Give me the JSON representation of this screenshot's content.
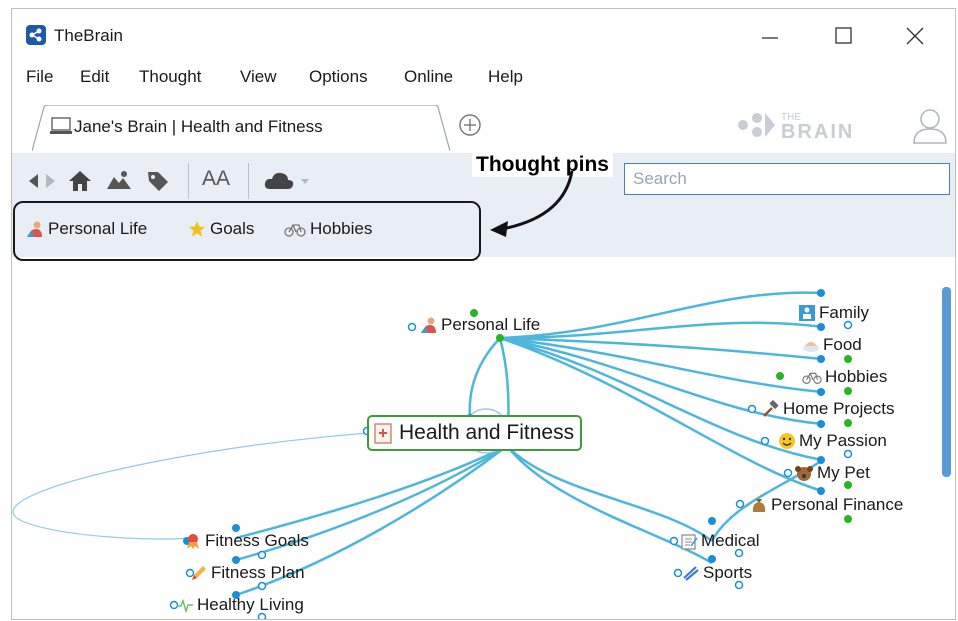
{
  "app": {
    "title": "TheBrain"
  },
  "menu": [
    "File",
    "Edit",
    "Thought",
    "View",
    "Options",
    "Online",
    "Help"
  ],
  "tab": {
    "label": "Jane's Brain | Health and Fitness"
  },
  "brand": {
    "logo_text_top": "THE",
    "logo_text_bottom": "BRAIN"
  },
  "toolbar": {
    "font_size_label": "AA"
  },
  "search": {
    "placeholder": "Search",
    "value": ""
  },
  "annotation": {
    "label": "Thought pins"
  },
  "pins": [
    {
      "label": "Personal Life",
      "icon": "person-icon"
    },
    {
      "label": "Goals",
      "icon": "star-icon"
    },
    {
      "label": "Hobbies",
      "icon": "bicycle-icon"
    }
  ],
  "plex": {
    "parent": {
      "label": "Personal Life"
    },
    "central": {
      "label": "Health and Fitness"
    },
    "jumps": [
      {
        "label": "Family"
      },
      {
        "label": "Food"
      },
      {
        "label": "Hobbies"
      },
      {
        "label": "Home Projects"
      },
      {
        "label": "My Passion"
      },
      {
        "label": "My Pet"
      },
      {
        "label": "Personal Finance"
      }
    ],
    "children": [
      {
        "label": "Fitness Goals"
      },
      {
        "label": "Fitness Plan"
      },
      {
        "label": "Healthy Living"
      },
      {
        "label": "Medical"
      },
      {
        "label": "Sports"
      }
    ]
  },
  "colors": {
    "link": "#4db6dc",
    "central_border": "#3d9a3d",
    "child_dot": "#1a8fd6",
    "jump_dot": "#27b427",
    "accent": "#4a7fc1"
  }
}
